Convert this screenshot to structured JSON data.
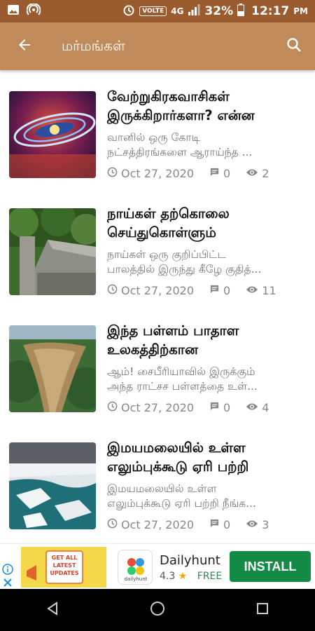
{
  "status_bar": {
    "network_label": "VOLTE",
    "network_type": "4G",
    "battery": "32%",
    "time": "12:17",
    "ampm": "PM"
  },
  "app_bar": {
    "title": "மர்மங்கள்",
    "back_icon": "arrow-left-icon",
    "search_icon": "search-icon"
  },
  "articles": [
    {
      "title": "வேற்றுகிரகவாசிகள் இருக்கிறார்களா? என்ன",
      "excerpt_line1": "வானில் ஒரு கோடி",
      "excerpt_line2": "நட்சத்திரங்களை ஆராய்ந்த ...",
      "date": "Oct 27, 2020",
      "comments": "0",
      "views": "2"
    },
    {
      "title": "நாய்கள் தற்கொலை செய்துகொள்ளும்",
      "excerpt_line1": "நாய்கள் ஒரு குறிப்பிட்ட",
      "excerpt_line2": "பாலத்தில் இருந்து கீழே குதித்...",
      "date": "Oct 27, 2020",
      "comments": "0",
      "views": "11"
    },
    {
      "title": "இந்த பள்ளம் பாதாள உலகத்திற்கான",
      "excerpt_line1": "ஆம்! சைபீரியாவில் இருக்கும்",
      "excerpt_line2": "அந்த ராட்சச பள்ளத்தை உள்...",
      "date": "Oct 27, 2020",
      "comments": "0",
      "views": "4"
    },
    {
      "title": "இமயமலையில் உள்ள எலும்புக்கூடு ஏரி பற்றி",
      "excerpt_line1": "இமயமலையில் உள்ள",
      "excerpt_line2": "எலும்புக்கூடு ஏரி பற்றி நீங்க...",
      "date": "Oct 27, 2020",
      "comments": "0",
      "views": "3"
    }
  ],
  "ad": {
    "banner_text": "GET ALL LATEST UPDATES",
    "app_name": "Dailyhunt",
    "rating": "4.3",
    "price": "FREE",
    "install_label": "INSTALL",
    "icon_caption": "dailyhunt"
  },
  "colors": {
    "status_bar": "#9a5b2e",
    "app_bar": "#c08a5b",
    "install": "#138a45"
  }
}
